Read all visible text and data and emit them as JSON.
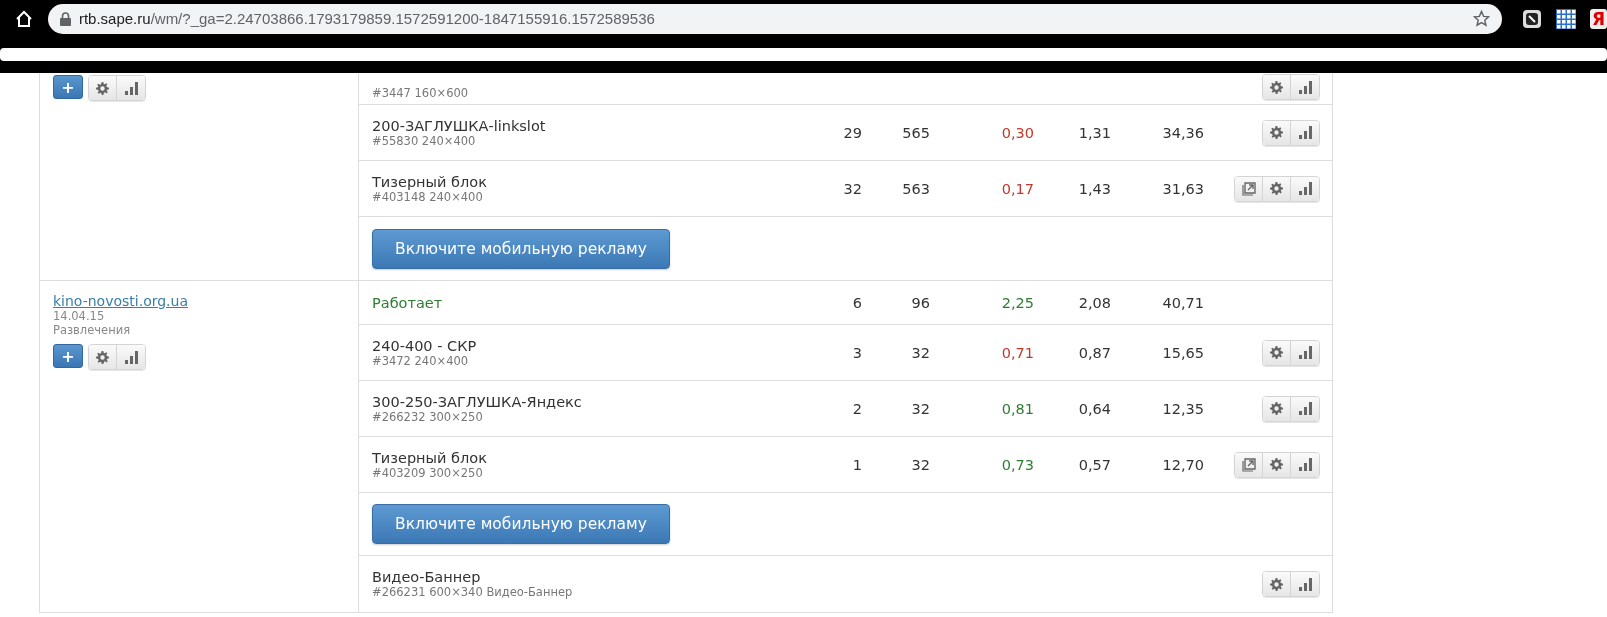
{
  "browser": {
    "url_host": "rtb.sape.ru",
    "url_path": "/wm/?_ga=2.24703866.1793179859.1572591200-1847155916.1572589536",
    "yandex_label": "Я"
  },
  "sites": [
    {
      "add_label": "+",
      "rows": [
        {
          "kind": "partial",
          "info": "#3447 160×600",
          "export": false
        },
        {
          "kind": "placement",
          "title": "200-ЗАГЛУШКА-linkslot",
          "info": "#55830 240×400",
          "values": [
            "29",
            "565",
            "0,30",
            "1,31",
            "34,36"
          ],
          "ctr_ok": false,
          "export": false
        },
        {
          "kind": "placement",
          "title": "Тизерный блок",
          "info": "#403148 240×400",
          "values": [
            "32",
            "563",
            "0,17",
            "1,43",
            "31,63"
          ],
          "ctr_ok": false,
          "export": true
        },
        {
          "kind": "mobile",
          "label": "Включите мобильную рекламу"
        }
      ]
    },
    {
      "name": "kino-novosti.org.ua",
      "date": "14.04.15",
      "category": "Развлечения",
      "add_label": "+",
      "rows": [
        {
          "kind": "status",
          "title": "Работает",
          "values": [
            "6",
            "96",
            "2,25",
            "2,08",
            "40,71"
          ],
          "ctr_ok": true
        },
        {
          "kind": "placement",
          "title": "240-400 - СКР",
          "info": "#3472 240×400",
          "values": [
            "3",
            "32",
            "0,71",
            "0,87",
            "15,65"
          ],
          "ctr_ok": false,
          "export": false
        },
        {
          "kind": "placement",
          "title": "300-250-ЗАГЛУШКА-Яндекс",
          "info": "#266232 300×250",
          "values": [
            "2",
            "32",
            "0,81",
            "0,64",
            "12,35"
          ],
          "ctr_ok": true,
          "export": false
        },
        {
          "kind": "placement",
          "title": "Тизерный блок",
          "info": "#403209 300×250",
          "values": [
            "1",
            "32",
            "0,73",
            "0,57",
            "12,70"
          ],
          "ctr_ok": true,
          "export": true
        },
        {
          "kind": "mobile",
          "label": "Включите мобильную рекламу"
        },
        {
          "kind": "placement",
          "title": "Видео-Баннер",
          "info": "#266231 600×340 Видео-Баннер",
          "values": [],
          "export": false
        }
      ]
    }
  ]
}
